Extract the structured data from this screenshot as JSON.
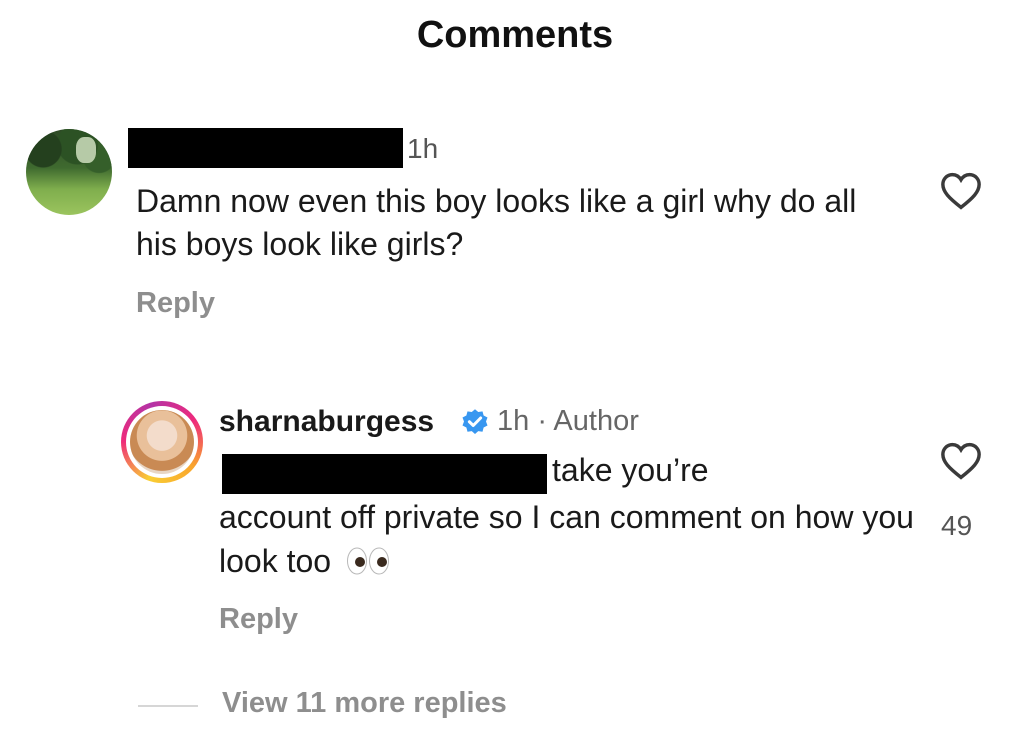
{
  "header": {
    "title": "Comments"
  },
  "comments": [
    {
      "username": "",
      "time": "1h",
      "text": "Damn now even this boy looks like a girl why do all his boys look like girls?",
      "reply_label": "Reply",
      "liked": false
    }
  ],
  "replies": [
    {
      "username": "sharnaburgess",
      "verified": true,
      "meta": "1h · Author",
      "text_first_line": "take you’re",
      "text_rest": "account off private so I can comment on how you look too",
      "emoji": "eyes-emoji",
      "likes": "49",
      "reply_label": "Reply"
    }
  ],
  "thread": {
    "view_more_label": "View 11 more replies"
  },
  "colors": {
    "text": "#262626",
    "secondary": "#8e8e8e",
    "verified_blue": "#3897f0"
  }
}
